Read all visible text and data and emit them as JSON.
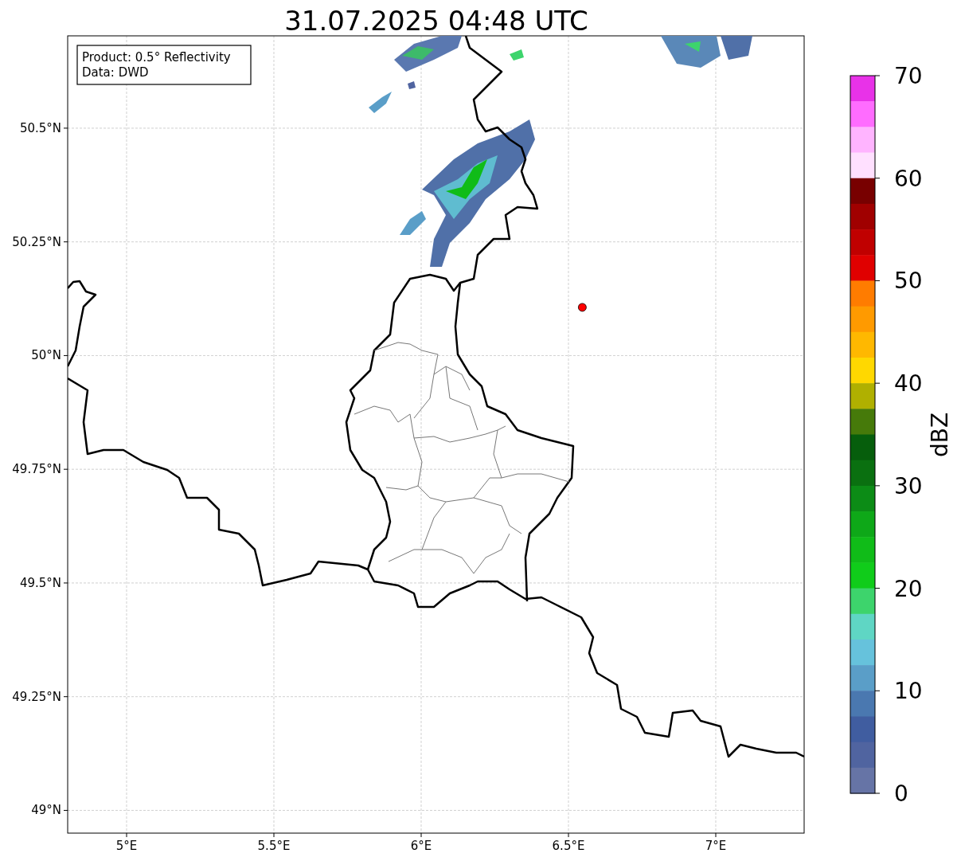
{
  "title": "31.07.2025 04:48 UTC",
  "info_box": [
    "Product: 0.5° Reflectivity",
    "Data: DWD"
  ],
  "map": {
    "chart_data": {
      "type": "scatter",
      "grid": true,
      "xlim": [
        4.8,
        7.3
      ],
      "ylim": [
        48.95,
        50.703
      ],
      "xticks": [
        {
          "value": 5,
          "label": "5°E"
        },
        {
          "value": 5.5,
          "label": "5.5°E"
        },
        {
          "value": 6,
          "label": "6°E"
        },
        {
          "value": 6.5,
          "label": "6.5°E"
        },
        {
          "value": 7,
          "label": "7°E"
        }
      ],
      "yticks": [
        {
          "value": 49,
          "label": "49°N"
        },
        {
          "value": 49.25,
          "label": "49.25°N"
        },
        {
          "value": 49.5,
          "label": "49.5°N"
        },
        {
          "value": 49.75,
          "label": "49.75°N"
        },
        {
          "value": 50,
          "label": "50°N"
        },
        {
          "value": 50.25,
          "label": "50.25°N"
        },
        {
          "value": 50.5,
          "label": "50.5°N"
        }
      ],
      "series": [
        {
          "color": "#ff0000",
          "x": [
            6.547
          ],
          "values": [
            50.106
          ]
        }
      ]
    }
  },
  "colorbar": {
    "label": "dBZ",
    "ticks": [
      "70",
      "60",
      "50",
      "40",
      "30",
      "20",
      "10",
      "0"
    ],
    "bins": [
      {
        "color": "#e832e8"
      },
      {
        "color": "#ff6cff"
      },
      {
        "color": "#ffb4ff"
      },
      {
        "color": "#ffe0ff"
      },
      {
        "color": "#780000"
      },
      {
        "color": "#a00000"
      },
      {
        "color": "#c00000"
      },
      {
        "color": "#e00000"
      },
      {
        "color": "#ff7c00"
      },
      {
        "color": "#ff9a00"
      },
      {
        "color": "#ffb800"
      },
      {
        "color": "#ffd800"
      },
      {
        "color": "#b0b000"
      },
      {
        "color": "#467a0a"
      },
      {
        "color": "#065e0c"
      },
      {
        "color": "#0a7010"
      },
      {
        "color": "#0c8c16"
      },
      {
        "color": "#0ea818"
      },
      {
        "color": "#10bc18"
      },
      {
        "color": "#10cc1a"
      },
      {
        "color": "#3dd46c"
      },
      {
        "color": "#5fd6c4"
      },
      {
        "color": "#66c2dc"
      },
      {
        "color": "#5a9ec8"
      },
      {
        "color": "#4a78b0"
      },
      {
        "color": "#405da0"
      },
      {
        "color": "#5064a0"
      },
      {
        "color": "#6674a6"
      }
    ]
  }
}
